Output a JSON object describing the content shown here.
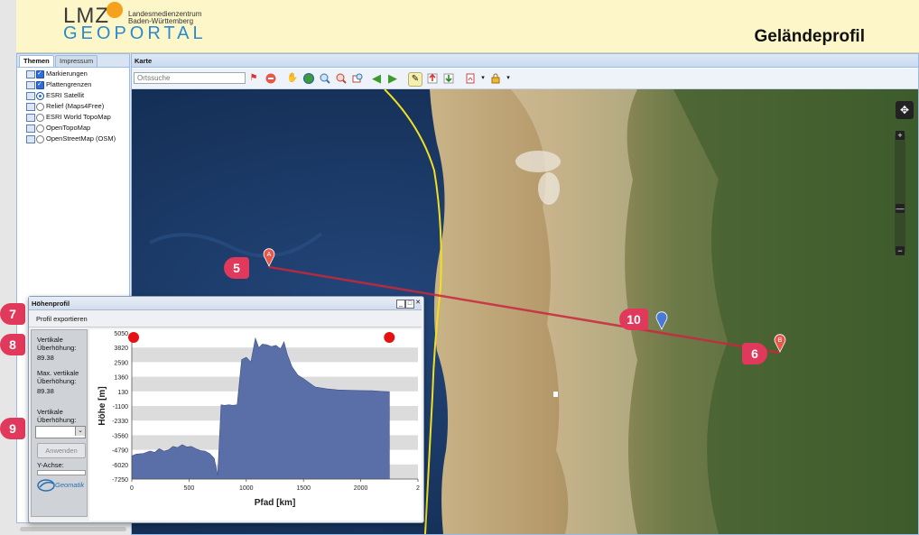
{
  "header": {
    "logo_text": "LMZ",
    "logo_sub_line1": "Landesmedienzentrum",
    "logo_sub_line2": "Baden-Württemberg",
    "logo_geo": "GEOPORTAL",
    "page_title": "Geländeprofil"
  },
  "left_panel": {
    "tabs": [
      {
        "label": "Themen",
        "active": true
      },
      {
        "label": "Impressum",
        "active": false
      }
    ],
    "layers": [
      {
        "label": "Markierungen",
        "control": "checkbox",
        "checked": true
      },
      {
        "label": "Plattengrenzen",
        "control": "checkbox",
        "checked": true
      },
      {
        "label": "ESRI Satellit",
        "control": "radio",
        "checked": true
      },
      {
        "label": "Relief (Maps4Free)",
        "control": "radio",
        "checked": false
      },
      {
        "label": "ESRI World TopoMap",
        "control": "radio",
        "checked": false
      },
      {
        "label": "OpenTopoMap",
        "control": "radio",
        "checked": false
      },
      {
        "label": "OpenStreetMap (OSM)",
        "control": "radio",
        "checked": false
      }
    ]
  },
  "map_panel": {
    "title": "Karte",
    "search_placeholder": "Ortssuche",
    "toolbar_icons": [
      "flag-icon",
      "remove-icon",
      "pan-hand-icon",
      "globe-icon",
      "zoom-in-icon",
      "zoom-out-icon",
      "zoom-box-icon",
      "back-arrow-icon",
      "forward-arrow-icon",
      "edit-profile-icon",
      "upload-icon",
      "download-icon",
      "pdf-icon",
      "lock-icon"
    ],
    "markers": [
      {
        "label": "A",
        "color": "#e8584a"
      },
      {
        "label": "B",
        "color": "#e8584a"
      }
    ],
    "zoom": {
      "plus": "+",
      "minus": "−",
      "mid": "—"
    }
  },
  "callouts": {
    "c5": "5",
    "c6": "6",
    "c7": "7",
    "c8": "8",
    "c9": "9",
    "c10": "10"
  },
  "profile_window": {
    "title": "Höhenprofil",
    "export_label": "Profil exportieren",
    "side": {
      "vert_label": "Vertikale Überhöhung:",
      "vert_value": "89.38",
      "max_label": "Max. vertikale Überhöhung:",
      "max_value": "89.38",
      "input_label": "Vertikale Überhöhung:",
      "apply_label": "Anwenden",
      "yaxis_label": "Y-Achse:",
      "logo_text": "Geomatik"
    }
  },
  "colors": {
    "callout": "#e0395b",
    "profile_fill": "#5a6fa8",
    "route_line": "#c8283c",
    "coastline": "#f0e020"
  },
  "chart_data": {
    "type": "area",
    "xlabel": "Pfad [km]",
    "ylabel": "Höhe [m]",
    "xlim": [
      0,
      2500
    ],
    "ylim": [
      -7250,
      5050
    ],
    "x_ticks": [
      "0",
      "500",
      "1000",
      "1500",
      "2000",
      "2"
    ],
    "y_ticks": [
      "5050",
      "3820",
      "2590",
      "1360",
      "130",
      "-1100",
      "-2330",
      "-3560",
      "-4790",
      "-6020",
      "-7250"
    ],
    "series": [
      {
        "x": [
          0,
          40,
          100,
          160,
          200,
          240,
          280,
          320,
          360,
          400,
          440,
          480,
          520,
          560,
          600,
          640,
          680,
          720,
          750,
          780,
          810,
          850,
          880,
          920,
          960,
          1000,
          1040,
          1080,
          1110,
          1140,
          1180,
          1220,
          1260,
          1300,
          1330,
          1360,
          1400,
          1450,
          1500,
          1600,
          1700,
          1800,
          1900,
          2000,
          2100,
          2180,
          2250
        ],
        "y": [
          -5300,
          -5150,
          -5100,
          -4900,
          -5000,
          -4700,
          -4900,
          -4800,
          -4500,
          -4600,
          -4350,
          -4550,
          -4500,
          -4700,
          -4850,
          -4900,
          -5100,
          -5500,
          -6950,
          -1000,
          -1050,
          -1000,
          -1050,
          -1000,
          2800,
          3000,
          2600,
          4600,
          3800,
          4100,
          4050,
          3900,
          4000,
          3700,
          4300,
          3200,
          2200,
          1500,
          1200,
          500,
          350,
          250,
          220,
          200,
          180,
          130,
          100
        ]
      }
    ],
    "endpoint_markers": [
      "A",
      "B"
    ],
    "grid": "horizontal bands"
  }
}
